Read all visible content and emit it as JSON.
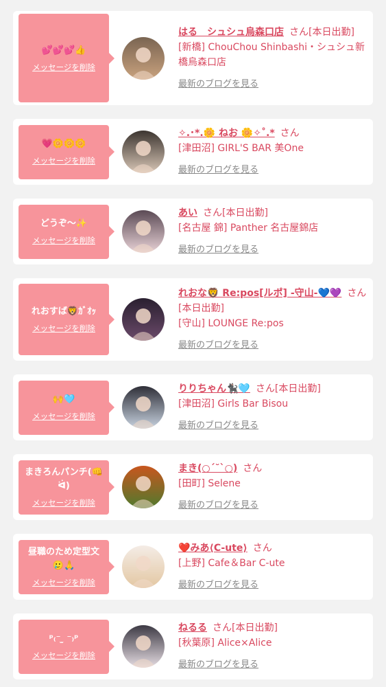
{
  "delete_label": "メッセージを削除",
  "blog_label": "最新のブログを見る",
  "san_label": "さん",
  "cards": [
    {
      "message": "💕💕💕👍",
      "cast_name": "はる　シュシュ烏森口店",
      "status": "[本日出勤]",
      "shop": "[新橋] ChouChou Shinbashi・シュシュ新橋烏森口店",
      "avatar_colors": [
        "#7a6552",
        "#c9a27e"
      ]
    },
    {
      "message": "💗🌼🌼🌼",
      "cast_name": "✧.･*.🌼 ねお 🌼✧˚.*",
      "status": "",
      "shop": "[津田沼] GIRL'S BAR 美One",
      "avatar_colors": [
        "#3c3530",
        "#d8c6b6"
      ]
    },
    {
      "message": "どうぞ〜✨",
      "cast_name": "あい",
      "status": "[本日出勤]",
      "shop": "[名古屋 錦] Panther 名古屋錦店",
      "avatar_colors": [
        "#5b4a55",
        "#e8d2d6"
      ]
    },
    {
      "message": "れおすば🦁ｶﾞｵｯ",
      "cast_name": "れおな🦁 Re:pos[ルポ] -守山-💙💜",
      "status": "[本日出勤]",
      "shop": "[守山] LOUNGE Re:pos",
      "avatar_colors": [
        "#2a2030",
        "#6b4a6a"
      ]
    },
    {
      "message": "🙌🩵",
      "cast_name": "りりちゃん🐈‍⬛🩵",
      "status": "[本日出勤]",
      "shop": "[津田沼] Girls Bar Bisou",
      "avatar_colors": [
        "#2f2f38",
        "#c8d3e0"
      ]
    },
    {
      "message": "まきろんパンチ(👊 ᐛ)",
      "cast_name": "まき(○ˊ˘ˋ○)",
      "status": "",
      "shop": "[田町] Selene",
      "avatar_colors": [
        "#c8561e",
        "#4f7a2e"
      ]
    },
    {
      "message": "昼職のため定型文🥲🙏",
      "cast_name": "❤️みあ⟨C-ute⟩",
      "status": "",
      "shop": "[上野] Cafe＆Bar C-ute",
      "avatar_colors": [
        "#f4ece6",
        "#e3c7a2"
      ]
    },
    {
      "message": "ᵖ₍⁻ ̫ ⁻₎ᵖ",
      "cast_name": "ねるる",
      "status": "[本日出勤]",
      "shop": "[秋葉原] Alice×Alice",
      "avatar_colors": [
        "#3d3a44",
        "#e6dde3"
      ]
    }
  ]
}
